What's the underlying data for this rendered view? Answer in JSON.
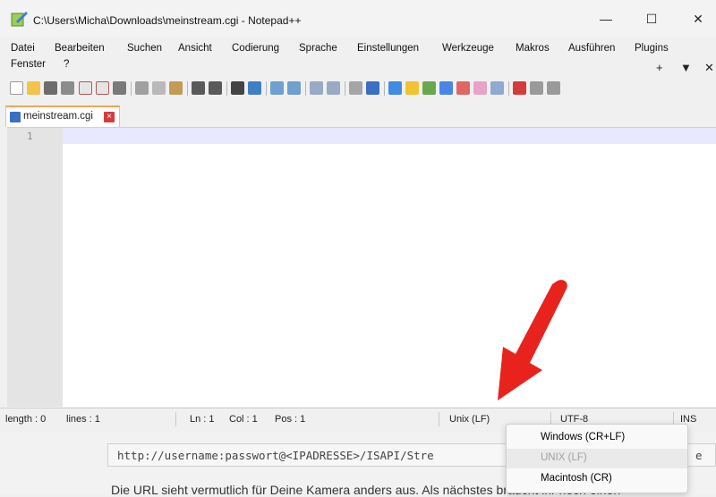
{
  "titlebar": {
    "title": "C:\\Users\\Micha\\Downloads\\meinstream.cgi - Notepad++",
    "minimize": "—",
    "maximize": "☐",
    "close": "✕"
  },
  "menu": {
    "items": [
      "Datei",
      "Bearbeiten",
      "Suchen",
      "Ansicht",
      "Codierung",
      "Sprache",
      "Einstellungen",
      "Werkzeuge",
      "Makros",
      "Ausführen",
      "Plugins"
    ],
    "row2": [
      "Fenster",
      "?"
    ],
    "right_plus": "+",
    "right_down": "▼",
    "right_close": "✕"
  },
  "tab": {
    "label": "meinstream.cgi",
    "close": "×"
  },
  "editor": {
    "line_number": "1"
  },
  "status": {
    "length": "length : 0",
    "lines": "lines : 1",
    "ln": "Ln : 1",
    "col": "Col : 1",
    "pos": "Pos : 1",
    "eol": "Unix (LF)",
    "encoding": "UTF-8",
    "ins": "INS"
  },
  "popup": {
    "items": [
      "Windows (CR+LF)",
      "UNIX (LF)",
      "Macintosh (CR)"
    ]
  },
  "webpage": {
    "code": "http://username:passwort@<IPADRESSE>/ISAPI/Stre",
    "code_tail": "e",
    "paragraph": "Die URL sieht vermutlich für Deine Kamera anders aus. Als nächstes braucht ihr noch einen"
  },
  "colors": {
    "annotation_arrow": "#e8221c",
    "tab_accent": "#f6a35b",
    "current_line": "#e8e8ff"
  }
}
